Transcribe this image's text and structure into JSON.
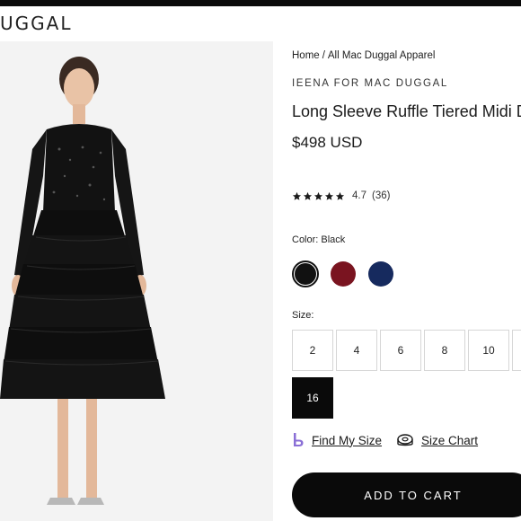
{
  "header": {
    "brand": "UGGAL"
  },
  "product": {
    "breadcrumb": {
      "home": "Home",
      "separator": "/",
      "category": "All Mac Duggal Apparel"
    },
    "designer": "IEENA FOR MAC DUGGAL",
    "title": "Long Sleeve Ruffle Tiered Midi Dr",
    "price": "$498 USD",
    "rating": {
      "stars": 5,
      "score": "4.7",
      "count": "(36)"
    },
    "color": {
      "label": "Color: Black",
      "swatches": [
        {
          "name": "Black",
          "hex": "#111111",
          "selected": true
        },
        {
          "name": "Burgundy",
          "hex": "#7a1420",
          "selected": false
        },
        {
          "name": "Navy",
          "hex": "#162a5e",
          "selected": false
        }
      ]
    },
    "size": {
      "label": "Size:",
      "options": [
        "2",
        "4",
        "6",
        "8",
        "10",
        "",
        "16"
      ],
      "selected": "16"
    },
    "links": {
      "find_my_size": "Find My Size",
      "size_chart": "Size Chart"
    },
    "add_to_cart": "ADD TO CART"
  },
  "colors": {
    "brand_icon": "#8a6fd6",
    "button_bg": "#0a0a0a"
  },
  "icons": {
    "find_my_size": "bold-b-icon",
    "size_chart": "tape-measure-icon",
    "rating": "star-icon"
  }
}
